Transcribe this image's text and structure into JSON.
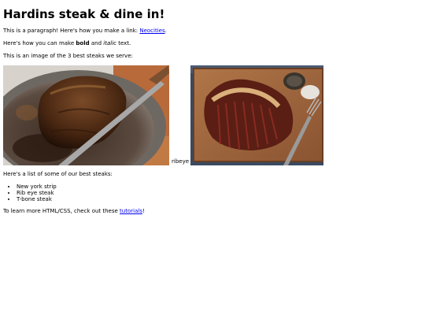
{
  "page": {
    "title": "Hardins steak & dine in!",
    "para1_text": "This is a paragraph! Here's how you make a link: ",
    "para1_link": "Neocities",
    "para1_end": ".",
    "para2_a": "Here's how you can make ",
    "para2_bold": "bold",
    "para2_b": " and ",
    "para2_italic": "italic",
    "para2_c": " text.",
    "para3": "This is an image of the 3 best steaks we serve:",
    "images": [
      {
        "alt": "",
        "shown": "photo: steak in cast-iron pan"
      },
      {
        "alt": "ribeye",
        "shown": "broken image alt text"
      },
      {
        "alt": "",
        "shown": "photo: sliced t-bone on cutting board"
      }
    ],
    "list_intro": "Here's a list of some of our best steaks:",
    "steaks": [
      "New york strip",
      "Rib eye steak",
      "T-bone steak"
    ],
    "footer_a": "To learn more HTML/CSS, check out these ",
    "footer_link": "tutorials",
    "footer_b": "!"
  }
}
